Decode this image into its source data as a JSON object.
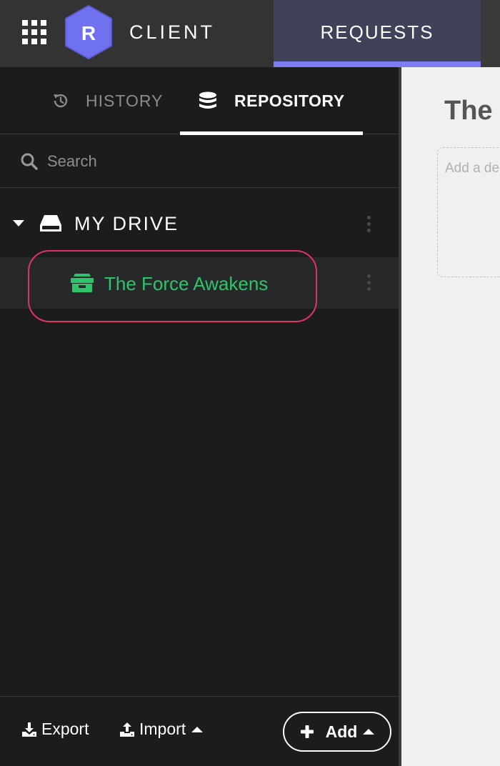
{
  "header": {
    "apps_icon": "apps-grid-icon",
    "logo_letter": "R",
    "app_title": "CLIENT",
    "tabs": [
      {
        "label": "REQUESTS",
        "active": true
      }
    ],
    "colors": {
      "accent": "#7b7ef2",
      "logo": "#6f71ee",
      "active_tab_bg": "#3f4258"
    }
  },
  "sidebar": {
    "tabs": [
      {
        "label": "HISTORY",
        "icon": "history-icon",
        "active": false
      },
      {
        "label": "REPOSITORY",
        "icon": "database-icon",
        "active": true
      }
    ],
    "search": {
      "placeholder": "Search",
      "value": ""
    },
    "tree": {
      "drive": {
        "label": "MY DRIVE",
        "icon": "drive-icon",
        "expanded": true
      },
      "projects": [
        {
          "label": "The Force Awakens",
          "icon": "project-box-icon",
          "selected": true,
          "highlighted": true
        }
      ]
    },
    "footer": {
      "export_label": "Export",
      "import_label": "Import",
      "add_label": "Add"
    },
    "colors": {
      "project_text": "#2ec56a",
      "highlight": "#e0336a"
    }
  },
  "main": {
    "title": "The Force Awakens",
    "description_placeholder": "Add a description"
  }
}
